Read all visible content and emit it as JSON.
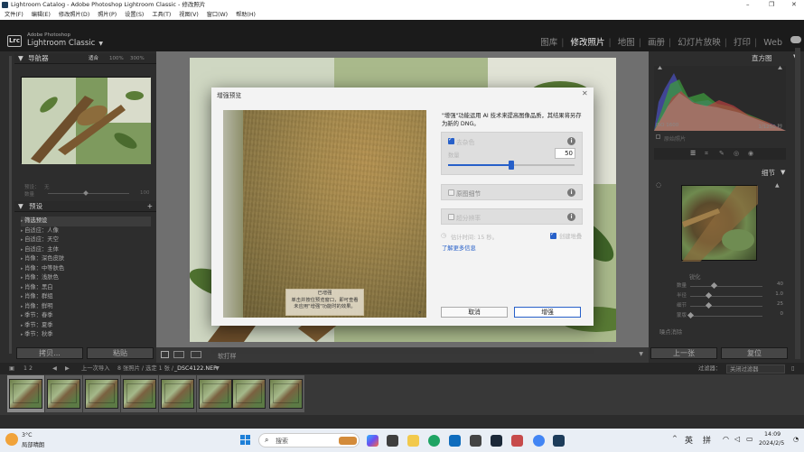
{
  "window": {
    "title": "Lightroom Catalog - Adobe Photoshop Lightroom Classic - 修改照片",
    "controls": [
      "–",
      "❐",
      "✕"
    ]
  },
  "menu": [
    "文件(F)",
    "编辑(E)",
    "修改照片(D)",
    "照片(P)",
    "设置(S)",
    "工具(T)",
    "视图(V)",
    "窗口(W)",
    "帮助(H)"
  ],
  "brand": {
    "logo": "Lrc",
    "line1": "Adobe Photoshop",
    "line2": "Lightroom Classic",
    "dropdown": "▼"
  },
  "modules": [
    "图库",
    "修改照片",
    "地图",
    "画册",
    "幻灯片放映",
    "打印",
    "Web"
  ],
  "active_module": "修改照片",
  "left_panel": {
    "navigator": {
      "title": "导航器",
      "zoom": [
        "适合",
        "100%",
        "300%"
      ]
    },
    "preview_labels": [
      "预设：",
      "无",
      "数量",
      "100"
    ],
    "presets": {
      "title": "预设",
      "items": [
        "筛选预设",
        "自适应：人像",
        "自适应：天空",
        "自适应：主体",
        "肖像：深色皮肤",
        "肖像：中等肤色",
        "肖像：浅肤色",
        "肖像：黑白",
        "肖像：群组",
        "肖像：鲜明",
        "季节：春季",
        "季节：夏季",
        "季节：秋季"
      ]
    },
    "buttons": {
      "copy": "拷贝...",
      "paste": "粘贴"
    }
  },
  "toolbar": {
    "softproof": "软打样"
  },
  "right_panel": {
    "histogram_title": "直方图",
    "iso": "ISO 1600",
    "shutter": "1/1250 秒",
    "original_photo": "原始照片",
    "detail_title": "细节",
    "sharpen_title": "锐化",
    "sliders": [
      {
        "label": "数量",
        "value": "40",
        "pos": 0.32
      },
      {
        "label": "半径",
        "value": "1.0",
        "pos": 0.25
      },
      {
        "label": "细节",
        "value": "25",
        "pos": 0.25
      },
      {
        "label": "蒙版",
        "value": "0",
        "pos": 0.0
      }
    ],
    "noise_title": "噪点消除",
    "buttons": {
      "prev": "上一张",
      "reset": "复位"
    }
  },
  "filmstrip_bar": {
    "pages": "1 2",
    "source": "上一次导入",
    "info": "8 张照片 / 选定 1 张 /",
    "filename": "_DSC4122.NEF",
    "filter_label": "过滤器：",
    "filter_value": "关闭过滤器",
    "thumb_count": 8
  },
  "taskbar": {
    "weather_temp": "3°C",
    "weather_desc": "局部晴朗",
    "search_placeholder": "搜索",
    "lang": "英",
    "ime": "拼",
    "time": "14:09",
    "date": "2024/2/5"
  },
  "dialog": {
    "title": "增强预览",
    "close": "✕",
    "description": "\"增强\"功能运用 AI 技术来提高图像品质，其结果将另存为新的 DNG。",
    "denoise": {
      "label": "去杂色",
      "checked": true,
      "amount_label": "数量",
      "amount": "50",
      "amount_fraction": 0.5
    },
    "raw_detail": {
      "label": "原图细节",
      "checked": false
    },
    "super_res": {
      "label": "超分辨率",
      "checked": false
    },
    "estimate": "估计时间: 15 秒。",
    "create_stack": {
      "label": "创建堆叠",
      "checked": true
    },
    "learn_more": "了解更多信息",
    "preview_note": {
      "line1": "已增强",
      "line2": "单击并按住预览窗口，即可查看",
      "line3": "未应用\"增强\"功能时的效果。"
    },
    "buttons": {
      "cancel": "取消",
      "enhance": "增强"
    }
  }
}
